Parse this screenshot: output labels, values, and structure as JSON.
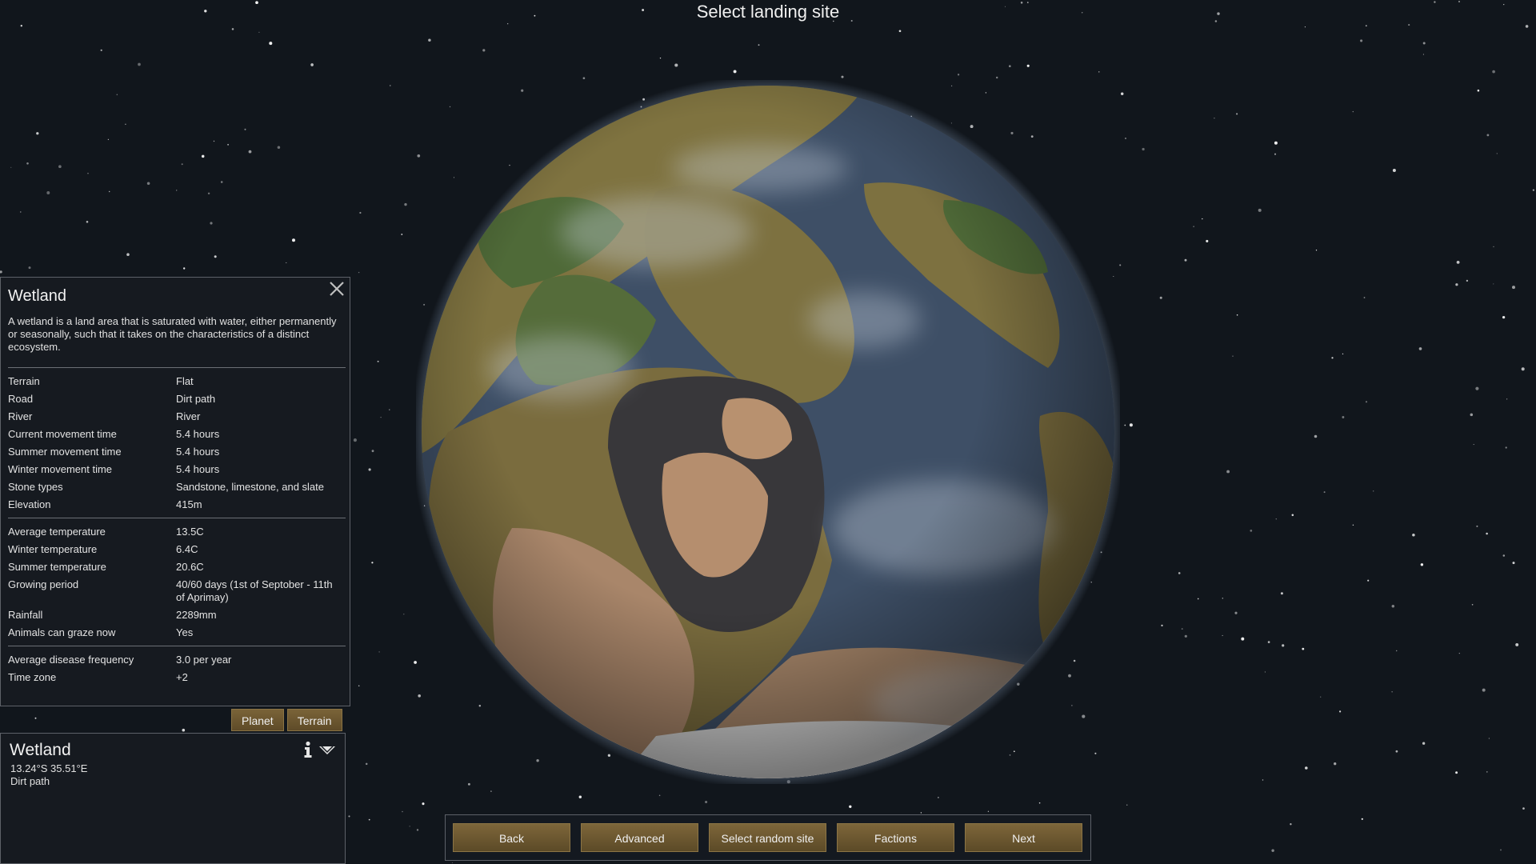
{
  "page": {
    "title": "Select landing site"
  },
  "inspect": {
    "title": "Wetland",
    "description": "A wetland is a land area that is saturated with water, either permanently or seasonally, such that it takes on the characteristics of a distinct ecosystem.",
    "groups": [
      [
        {
          "label": "Terrain",
          "value": "Flat"
        },
        {
          "label": "Road",
          "value": "Dirt path"
        },
        {
          "label": "River",
          "value": "River"
        },
        {
          "label": "Current movement time",
          "value": "5.4 hours"
        },
        {
          "label": "Summer movement time",
          "value": "5.4 hours"
        },
        {
          "label": "Winter movement time",
          "value": "5.4 hours"
        },
        {
          "label": "Stone types",
          "value": "Sandstone, limestone, and slate"
        },
        {
          "label": "Elevation",
          "value": "415m"
        }
      ],
      [
        {
          "label": "Average temperature",
          "value": "13.5C"
        },
        {
          "label": "Winter temperature",
          "value": "6.4C"
        },
        {
          "label": "Summer temperature",
          "value": "20.6C"
        },
        {
          "label": "Growing period",
          "value": "40/60 days (1st of Septober - 11th of Aprimay)"
        },
        {
          "label": "Rainfall",
          "value": "2289mm"
        },
        {
          "label": "Animals can graze now",
          "value": "Yes"
        }
      ],
      [
        {
          "label": "Average disease frequency",
          "value": "3.0 per year"
        },
        {
          "label": "Time zone",
          "value": "+2"
        }
      ]
    ]
  },
  "tabs": {
    "planet": "Planet",
    "terrain": "Terrain"
  },
  "selected": {
    "name": "Wetland",
    "coords": "13.24°S 35.51°E",
    "road": "Dirt path"
  },
  "buttons": {
    "back": "Back",
    "advanced": "Advanced",
    "random": "Select random site",
    "factions": "Factions",
    "next": "Next"
  },
  "colors": {
    "ocean": "#3e4f66",
    "land": "#7f7340",
    "desert": "#b58e6e",
    "forest": "#4f6a38",
    "dark": "#38373a",
    "button": "#6e5a32"
  }
}
